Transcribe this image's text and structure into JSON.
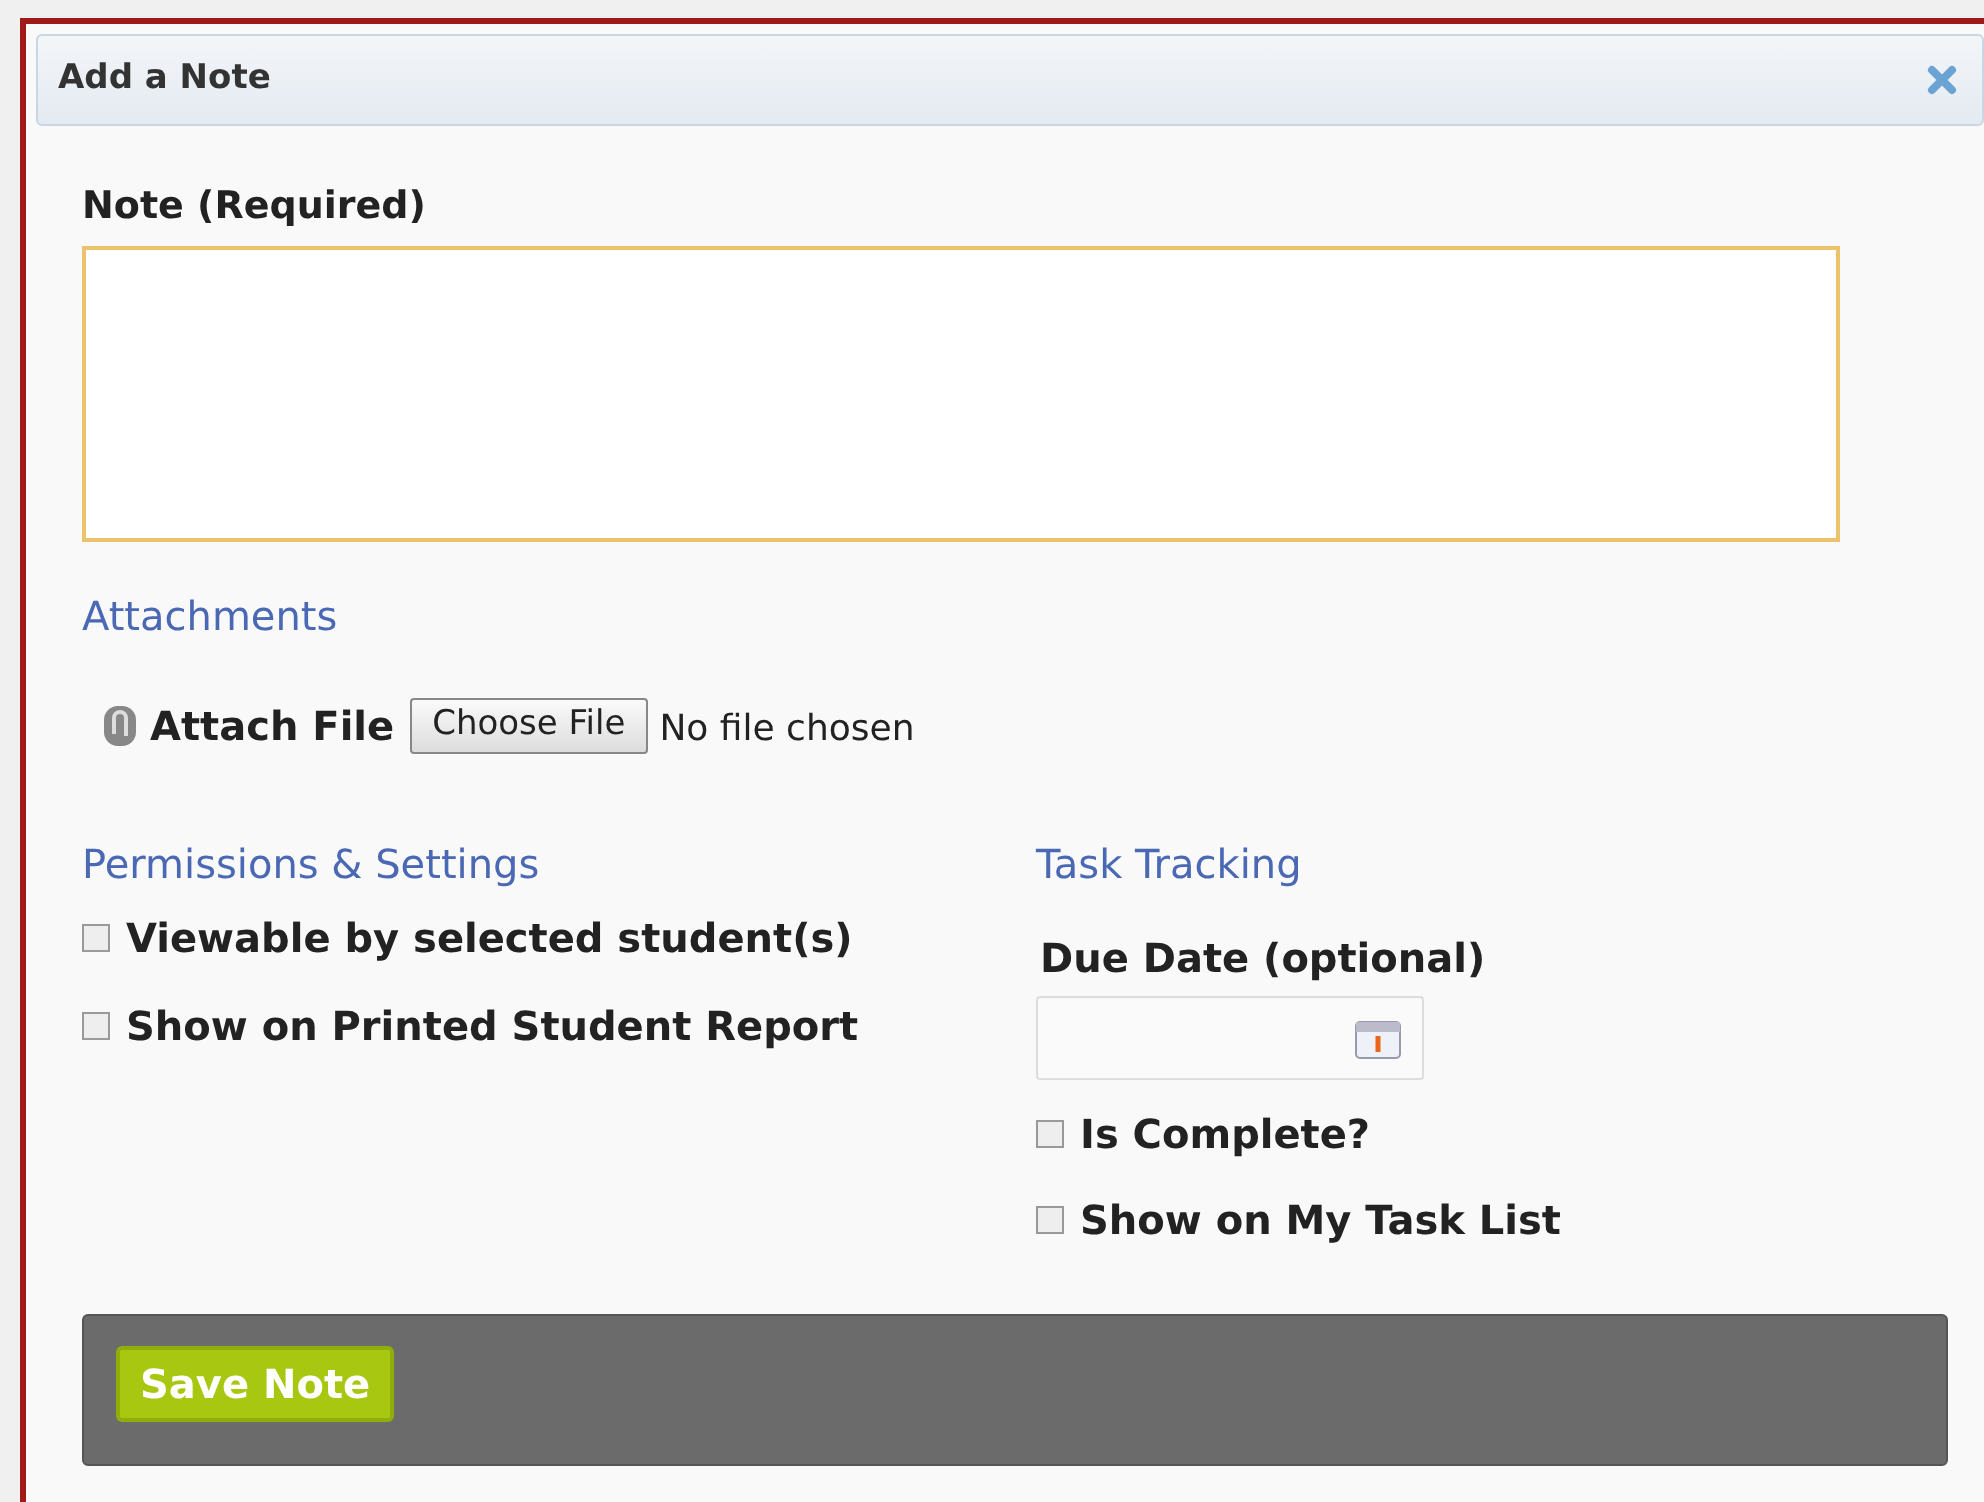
{
  "dialog": {
    "title": "Add a Note"
  },
  "note": {
    "label": "Note (Required)"
  },
  "attachments": {
    "heading": "Attachments",
    "label": "Attach File",
    "button": "Choose File",
    "status": "No file chosen"
  },
  "permissions": {
    "heading": "Permissions & Settings",
    "options": [
      {
        "label": "Viewable by selected student(s)",
        "checked": false
      },
      {
        "label": "Show on Printed Student Report",
        "checked": false
      }
    ]
  },
  "task_tracking": {
    "heading": "Task Tracking",
    "due_date_label": "Due Date (optional)",
    "options": [
      {
        "label": "Is Complete?",
        "checked": false
      },
      {
        "label": "Show on My Task List",
        "checked": false
      }
    ]
  },
  "footer": {
    "save_button": "Save Note"
  }
}
